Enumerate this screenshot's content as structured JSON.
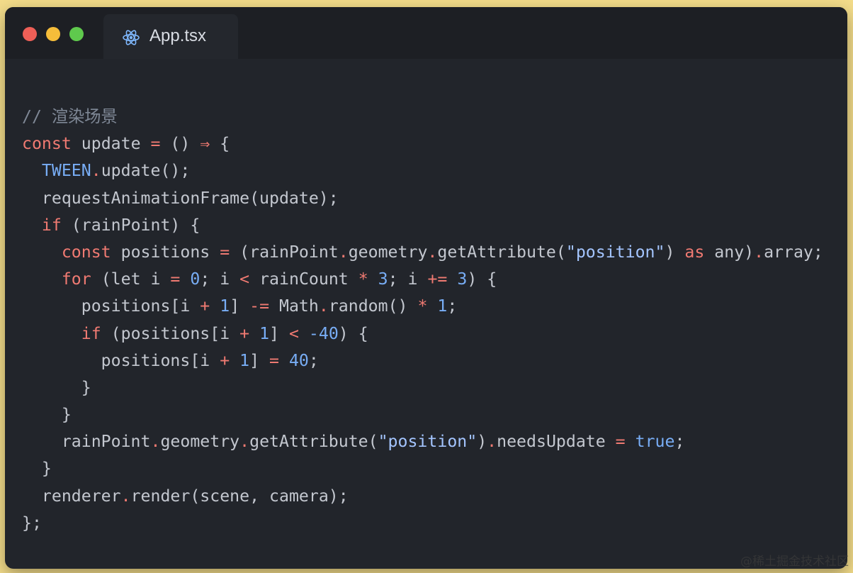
{
  "window": {
    "tab": {
      "label": "App.tsx",
      "icon": "react-icon"
    },
    "traffic_lights": {
      "close": "#ee5f57",
      "minimize": "#f6bd3a",
      "maximize": "#5fc94d"
    }
  },
  "code": {
    "lines": [
      [
        {
          "t": "comment",
          "v": "// 渲染场景"
        }
      ],
      [
        {
          "t": "keyword",
          "v": "const"
        },
        {
          "t": "plain",
          "v": " update "
        },
        {
          "t": "operator",
          "v": "="
        },
        {
          "t": "plain",
          "v": " () "
        },
        {
          "t": "operator",
          "v": "⇒"
        },
        {
          "t": "plain",
          "v": " {"
        }
      ],
      [
        {
          "t": "plain",
          "v": "  "
        },
        {
          "t": "type",
          "v": "TWEEN"
        },
        {
          "t": "operator",
          "v": "."
        },
        {
          "t": "plain",
          "v": "update();"
        }
      ],
      [
        {
          "t": "plain",
          "v": "  requestAnimationFrame(update);"
        }
      ],
      [
        {
          "t": "plain",
          "v": "  "
        },
        {
          "t": "keyword",
          "v": "if"
        },
        {
          "t": "plain",
          "v": " (rainPoint) {"
        }
      ],
      [
        {
          "t": "plain",
          "v": "    "
        },
        {
          "t": "keyword",
          "v": "const"
        },
        {
          "t": "plain",
          "v": " positions "
        },
        {
          "t": "operator",
          "v": "="
        },
        {
          "t": "plain",
          "v": " (rainPoint"
        },
        {
          "t": "operator",
          "v": "."
        },
        {
          "t": "plain",
          "v": "geometry"
        },
        {
          "t": "operator",
          "v": "."
        },
        {
          "t": "plain",
          "v": "getAttribute("
        },
        {
          "t": "string",
          "v": "\"position\""
        },
        {
          "t": "plain",
          "v": ") "
        },
        {
          "t": "keyword",
          "v": "as"
        },
        {
          "t": "plain",
          "v": " any)"
        },
        {
          "t": "operator",
          "v": "."
        },
        {
          "t": "plain",
          "v": "array;"
        }
      ],
      [
        {
          "t": "plain",
          "v": "    "
        },
        {
          "t": "keyword",
          "v": "for"
        },
        {
          "t": "plain",
          "v": " (let i "
        },
        {
          "t": "operator",
          "v": "="
        },
        {
          "t": "plain",
          "v": " "
        },
        {
          "t": "number",
          "v": "0"
        },
        {
          "t": "plain",
          "v": "; i "
        },
        {
          "t": "operator",
          "v": "<"
        },
        {
          "t": "plain",
          "v": " rainCount "
        },
        {
          "t": "operator",
          "v": "*"
        },
        {
          "t": "plain",
          "v": " "
        },
        {
          "t": "number",
          "v": "3"
        },
        {
          "t": "plain",
          "v": "; i "
        },
        {
          "t": "operator",
          "v": "+="
        },
        {
          "t": "plain",
          "v": " "
        },
        {
          "t": "number",
          "v": "3"
        },
        {
          "t": "plain",
          "v": ") {"
        }
      ],
      [
        {
          "t": "plain",
          "v": "      positions[i "
        },
        {
          "t": "operator",
          "v": "+"
        },
        {
          "t": "plain",
          "v": " "
        },
        {
          "t": "number",
          "v": "1"
        },
        {
          "t": "plain",
          "v": "] "
        },
        {
          "t": "operator",
          "v": "-="
        },
        {
          "t": "plain",
          "v": " Math"
        },
        {
          "t": "operator",
          "v": "."
        },
        {
          "t": "plain",
          "v": "random() "
        },
        {
          "t": "operator",
          "v": "*"
        },
        {
          "t": "plain",
          "v": " "
        },
        {
          "t": "number",
          "v": "1"
        },
        {
          "t": "plain",
          "v": ";"
        }
      ],
      [
        {
          "t": "plain",
          "v": "      "
        },
        {
          "t": "keyword",
          "v": "if"
        },
        {
          "t": "plain",
          "v": " (positions[i "
        },
        {
          "t": "operator",
          "v": "+"
        },
        {
          "t": "plain",
          "v": " "
        },
        {
          "t": "number",
          "v": "1"
        },
        {
          "t": "plain",
          "v": "] "
        },
        {
          "t": "operator",
          "v": "<"
        },
        {
          "t": "plain",
          "v": " "
        },
        {
          "t": "number",
          "v": "-40"
        },
        {
          "t": "plain",
          "v": ") {"
        }
      ],
      [
        {
          "t": "plain",
          "v": "        positions[i "
        },
        {
          "t": "operator",
          "v": "+"
        },
        {
          "t": "plain",
          "v": " "
        },
        {
          "t": "number",
          "v": "1"
        },
        {
          "t": "plain",
          "v": "] "
        },
        {
          "t": "operator",
          "v": "="
        },
        {
          "t": "plain",
          "v": " "
        },
        {
          "t": "number",
          "v": "40"
        },
        {
          "t": "plain",
          "v": ";"
        }
      ],
      [
        {
          "t": "plain",
          "v": "      }"
        }
      ],
      [
        {
          "t": "plain",
          "v": "    }"
        }
      ],
      [
        {
          "t": "plain",
          "v": "    rainPoint"
        },
        {
          "t": "operator",
          "v": "."
        },
        {
          "t": "plain",
          "v": "geometry"
        },
        {
          "t": "operator",
          "v": "."
        },
        {
          "t": "plain",
          "v": "getAttribute("
        },
        {
          "t": "string",
          "v": "\"position\""
        },
        {
          "t": "plain",
          "v": ")"
        },
        {
          "t": "operator",
          "v": "."
        },
        {
          "t": "plain",
          "v": "needsUpdate "
        },
        {
          "t": "operator",
          "v": "="
        },
        {
          "t": "plain",
          "v": " "
        },
        {
          "t": "number",
          "v": "true"
        },
        {
          "t": "plain",
          "v": ";"
        }
      ],
      [
        {
          "t": "plain",
          "v": "  }"
        }
      ],
      [
        {
          "t": "plain",
          "v": "  renderer"
        },
        {
          "t": "operator",
          "v": "."
        },
        {
          "t": "plain",
          "v": "render(scene, camera);"
        }
      ],
      [
        {
          "t": "plain",
          "v": "};"
        }
      ]
    ]
  },
  "watermark": "@稀土掘金技术社区"
}
